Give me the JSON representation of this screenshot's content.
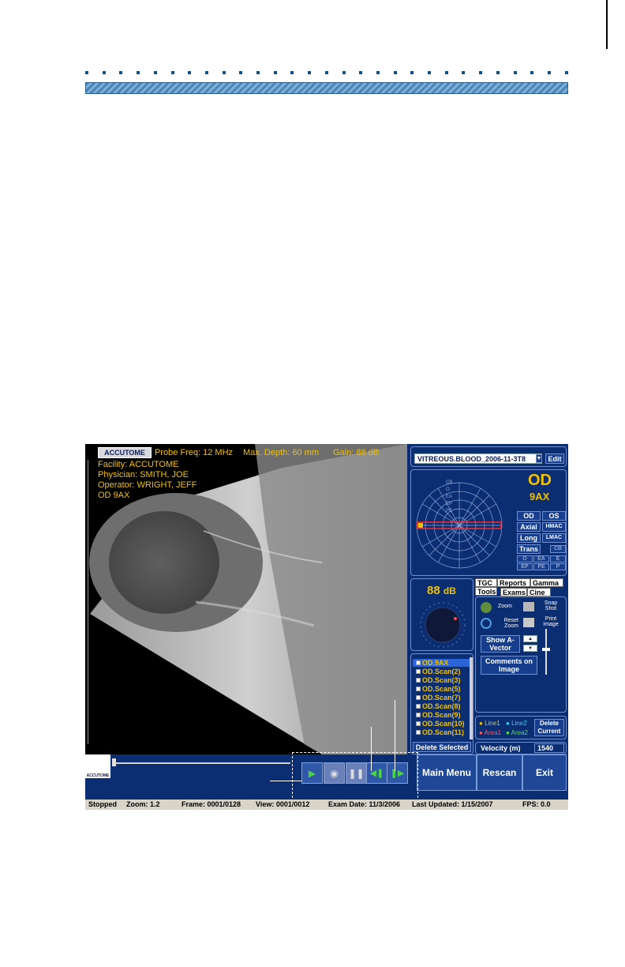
{
  "overlay": {
    "logo": "ACCUTOME",
    "probe_freq": "Probe Freq: 12 MHz",
    "max_depth": "Max. Depth: 60 mm",
    "gain": "Gain: 88 dB",
    "facility": "Facility: ACCUTOME",
    "physician": "Physician: SMITH, JOE",
    "operator": "Operator: WRIGHT, JEFF",
    "scan_id": "OD  9AX"
  },
  "exam_select": {
    "value": "VITREOUS.BLOOD_2006-11-3T8",
    "edit_label": "Edit"
  },
  "probe_panel": {
    "clock_labels": [
      "CB",
      "O",
      "EA",
      "EP",
      "PE"
    ],
    "eye": "OD",
    "scan": "9AX",
    "buttons": [
      "OD",
      "OS",
      "Axial",
      "HMAC",
      "Long",
      "LMAC",
      "Trans",
      "CB",
      "O",
      "EA",
      "E",
      "EP",
      "PE",
      "P"
    ]
  },
  "gain_panel": {
    "value": "88",
    "unit": "dB"
  },
  "tabs": {
    "row1": [
      "TGC",
      "Reports",
      "Gamma"
    ],
    "row2": [
      "Tools",
      "Exams",
      "Cine"
    ]
  },
  "tools": {
    "zoom": "Zoom",
    "snap_shot": "Snap Shot",
    "reset_zoom": "Reset Zoom",
    "print_image": "Print Image",
    "show_avector": "Show A-Vector",
    "comments": "Comments on Image"
  },
  "scan_list": {
    "items": [
      "OD.9AX",
      "OD.Scan(2)",
      "OD.Scan(3)",
      "OD.Scan(5)",
      "OD.Scan(7)",
      "OD.Scan(8)",
      "OD.Scan(9)",
      "OD.Scan(10)",
      "OD.Scan(11)"
    ],
    "delete_label": "Delete Selected"
  },
  "measure": {
    "line1": "Line1",
    "line2": "Line2",
    "area1": "Area1",
    "area2": "Area2",
    "delete_current": "Delete Current"
  },
  "velocity": {
    "label": "Velocity (m)",
    "value": "1540"
  },
  "nav": {
    "main_menu": "Main Menu",
    "rescan": "Rescan",
    "exit": "Exit"
  },
  "status": {
    "state": "Stopped",
    "zoom": "Zoom: 1.2",
    "frame": "Frame: 0001/0128",
    "view": "View: 0001/0012",
    "exam_date": "Exam Date: 11/3/2006",
    "last_updated": "Last Updated: 1/15/2007",
    "fps": "FPS: 0.0"
  },
  "bottom_logo": "ACCUTOME",
  "colors": {
    "accent_yellow": "#f2c200",
    "panel_navy": "#0b2d72",
    "header_blue": "#4a86b7"
  }
}
